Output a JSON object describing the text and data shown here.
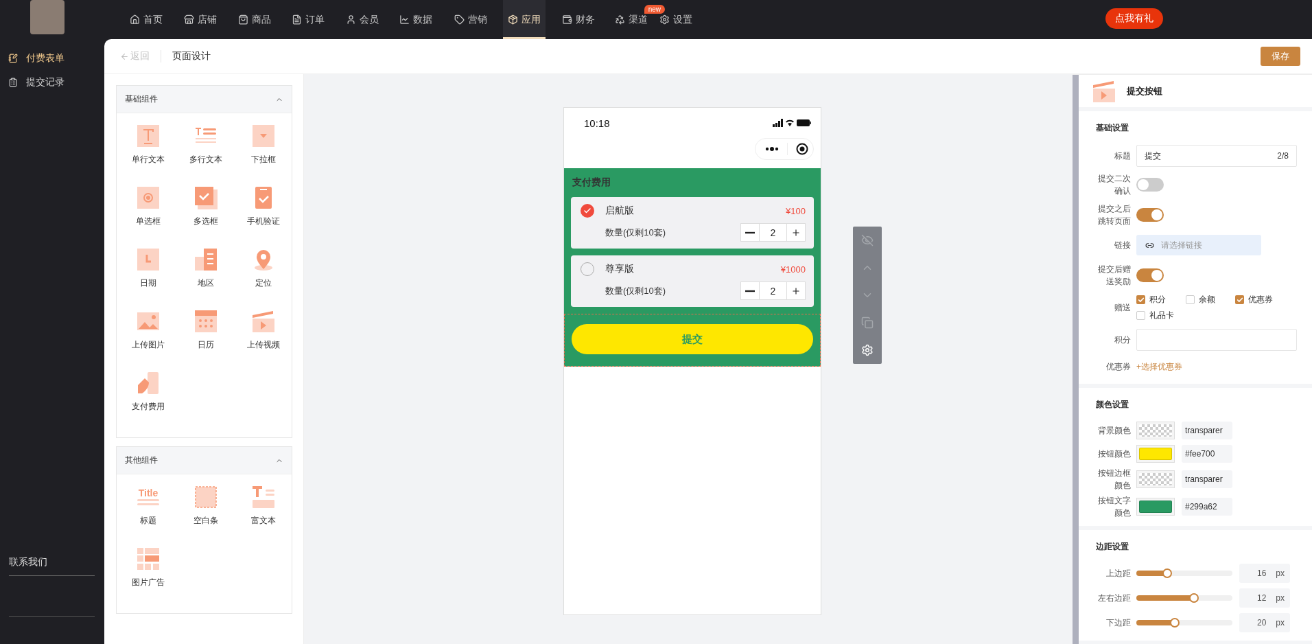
{
  "top_nav": {
    "items": [
      {
        "label": "首页",
        "selected": false
      },
      {
        "label": "店铺",
        "selected": false
      },
      {
        "label": "商品",
        "selected": false
      },
      {
        "label": "订单",
        "selected": false
      },
      {
        "label": "会员",
        "selected": false
      },
      {
        "label": "数据",
        "selected": false
      },
      {
        "label": "营销",
        "selected": false
      },
      {
        "label": "应用",
        "selected": true
      },
      {
        "label": "财务",
        "selected": false
      },
      {
        "label": "渠道",
        "selected": false,
        "badge": "new"
      },
      {
        "label": "设置",
        "selected": false
      }
    ],
    "gift_button": "点我有礼"
  },
  "sidebar": {
    "items": [
      {
        "label": "付费表单",
        "selected": true
      },
      {
        "label": "提交记录",
        "selected": false
      }
    ],
    "footer_title": "联系我们"
  },
  "header": {
    "back_label": "返回",
    "title": "页面设计",
    "save_button": "保存"
  },
  "component_groups": [
    {
      "title": "基础组件",
      "expanded": true,
      "items": [
        {
          "label": "单行文本"
        },
        {
          "label": "多行文本"
        },
        {
          "label": "下拉框"
        },
        {
          "label": "单选框"
        },
        {
          "label": "多选框"
        },
        {
          "label": "手机验证"
        },
        {
          "label": "日期"
        },
        {
          "label": "地区"
        },
        {
          "label": "定位"
        },
        {
          "label": "上传图片"
        },
        {
          "label": "日历"
        },
        {
          "label": "上传视频"
        },
        {
          "label": "支付费用"
        }
      ]
    },
    {
      "title": "其他组件",
      "expanded": true,
      "items": [
        {
          "label": "标题",
          "icon_text": "Title"
        },
        {
          "label": "空白条"
        },
        {
          "label": "富文本"
        },
        {
          "label": "图片广告"
        }
      ]
    }
  ],
  "phone": {
    "time": "10:18",
    "section_title": "支付费用",
    "options": [
      {
        "name": "启航版",
        "price": "¥100",
        "selected": true,
        "quantity_label": "数量(仅剩10套)",
        "quantity": "2"
      },
      {
        "name": "尊享版",
        "price": "¥1000",
        "selected": false,
        "quantity_label": "数量(仅剩10套)",
        "quantity": "2"
      }
    ],
    "submit_button": "提交"
  },
  "settings": {
    "title": "提交按钮",
    "sections": [
      {
        "title": "基础设置",
        "rows": [
          {
            "kind": "text",
            "label": "标题",
            "value": "提交",
            "counter": "2/8"
          },
          {
            "kind": "toggle",
            "label": "提交二次确认",
            "on": false
          },
          {
            "kind": "toggle",
            "label": "提交之后跳转页面",
            "on": true
          },
          {
            "kind": "link",
            "label": "链接",
            "placeholder": "请选择链接"
          },
          {
            "kind": "toggle",
            "label": "提交后赠送奖励",
            "on": true
          },
          {
            "kind": "checks",
            "label": "赠送",
            "options": [
              {
                "label": "积分",
                "checked": true
              },
              {
                "label": "余额",
                "checked": false
              },
              {
                "label": "优惠券",
                "checked": true
              },
              {
                "label": "礼品卡",
                "checked": false
              }
            ]
          },
          {
            "kind": "input",
            "label": "积分"
          },
          {
            "kind": "action",
            "label": "优惠券",
            "action": "+选择优惠券"
          }
        ]
      },
      {
        "title": "颜色设置",
        "rows": [
          {
            "kind": "transparent",
            "label": "背景颜色",
            "value": "transparer"
          },
          {
            "kind": "solid",
            "label": "按钮颜色",
            "color": "#fee700",
            "value": "#fee700"
          },
          {
            "kind": "transparent",
            "label": "按钮边框颜色",
            "value": "transparer"
          },
          {
            "kind": "solid",
            "label": "按钮文字颜色",
            "color": "#299a62",
            "value": "#299a62"
          }
        ]
      },
      {
        "title": "边距设置",
        "rows": [
          {
            "kind": "slider",
            "label": "上边距",
            "level": 0.32,
            "value": "16",
            "unit": "px"
          },
          {
            "kind": "slider",
            "label": "左右边距",
            "level": 0.6,
            "value": "12",
            "unit": "px"
          },
          {
            "kind": "slider",
            "label": "下边距",
            "level": 0.4,
            "value": "20",
            "unit": "px"
          }
        ]
      }
    ]
  }
}
